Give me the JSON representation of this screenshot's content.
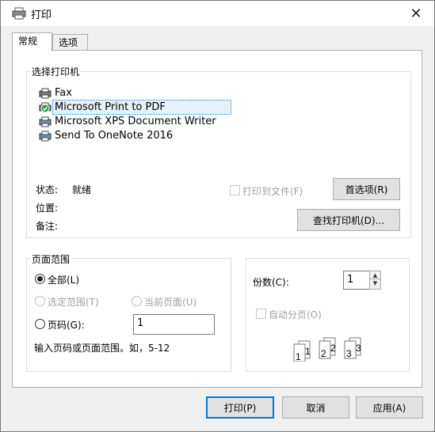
{
  "window": {
    "title": "打印",
    "close_icon": "close-icon"
  },
  "tabs": [
    {
      "label": "常规",
      "active": true
    },
    {
      "label": "选项",
      "active": false
    }
  ],
  "printer_group": {
    "legend": "选择打印机",
    "printers": [
      {
        "name": "Fax",
        "icon": "fax-printer-icon",
        "selected": false
      },
      {
        "name": "Microsoft Print to PDF",
        "icon": "default-printer-icon",
        "selected": true
      },
      {
        "name": "Microsoft XPS Document Writer",
        "icon": "printer-icon",
        "selected": false
      },
      {
        "name": "Send To OneNote 2016",
        "icon": "printer-icon",
        "selected": false
      }
    ],
    "status_label": "状态:",
    "status_value": "就绪",
    "location_label": "位置:",
    "comment_label": "备注:",
    "print_to_file_label": "打印到文件(F)",
    "preferences_button": "首选项(R)",
    "find_printer_button": "查找打印机(D)..."
  },
  "page_range": {
    "legend": "页面范围",
    "all_label": "全部(L)",
    "selection_label": "选定范围(T)",
    "current_page_label": "当前页面(U)",
    "pages_label": "页码(G):",
    "pages_value": "1",
    "hint": "输入页码或页面范围。如，5-12",
    "selected_option": "all"
  },
  "copies": {
    "label": "份数(C):",
    "value": "1",
    "collate_label": "自动分页(O)",
    "collate_checked": false,
    "collate_pages": [
      "1",
      "1",
      "2",
      "2",
      "3",
      "3"
    ]
  },
  "footer": {
    "print_button": "打印(P)",
    "cancel_button": "取消",
    "apply_button": "应用(A)"
  },
  "colors": {
    "accent": "#0078d7",
    "selection_bg": "#e5f1fb",
    "dialog_bg": "#f0f0f0"
  }
}
